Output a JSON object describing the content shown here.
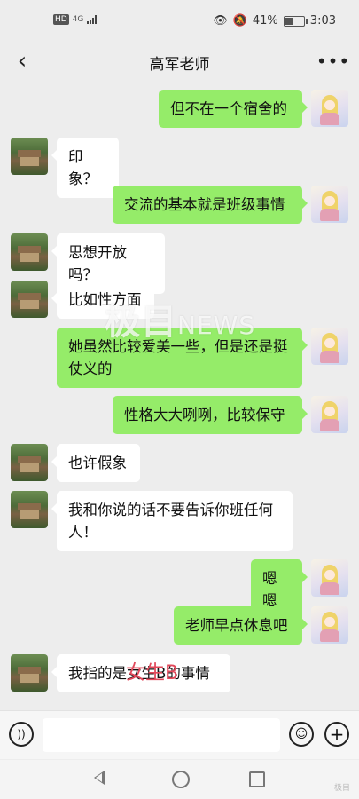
{
  "status_bar": {
    "network_badge": "HD",
    "network_type": "4G",
    "battery_percent": "41%",
    "time": "3:03"
  },
  "header": {
    "title": "高军老师"
  },
  "messages": [
    {
      "sender": "me",
      "text": "但不在一个宿舍的"
    },
    {
      "sender": "teacher",
      "text": "印象？"
    },
    {
      "sender": "me",
      "text": "交流的基本就是班级事情"
    },
    {
      "sender": "teacher",
      "text": "思想开放吗？"
    },
    {
      "sender": "teacher",
      "text": "比如性方面"
    },
    {
      "sender": "me",
      "text": "她虽然比较爱美一些，但是还是挺仗义的"
    },
    {
      "sender": "me",
      "text": "性格大大咧咧，比较保守"
    },
    {
      "sender": "teacher",
      "text": "也许假象"
    },
    {
      "sender": "teacher",
      "text": "我和你说的话不要告诉你班任何人！"
    },
    {
      "sender": "me",
      "text": "嗯嗯"
    },
    {
      "sender": "me",
      "text": "老师早点休息吧"
    },
    {
      "sender": "teacher",
      "text": "我指的是女生B的事情"
    }
  ],
  "watermark": {
    "main": "极目",
    "sub": "NEWS"
  },
  "overlay_label": "女生B",
  "corner_mark": "极目",
  "colors": {
    "outgoing_bubble": "#95ec69",
    "incoming_bubble": "#ffffff",
    "background": "#ededed"
  }
}
